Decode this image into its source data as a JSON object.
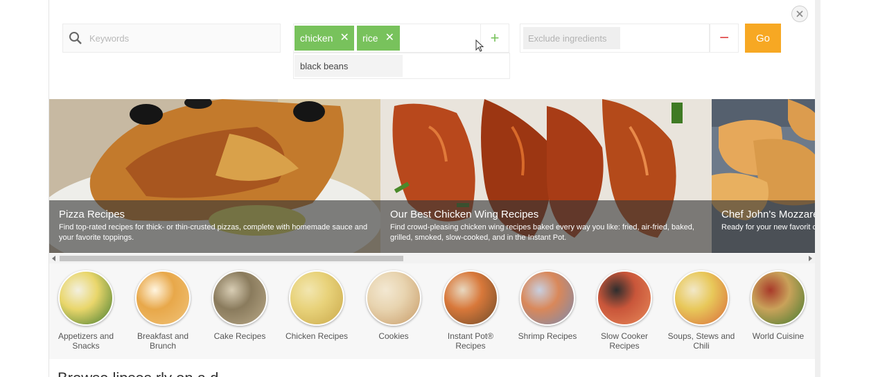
{
  "search": {
    "keyword_placeholder": "Keywords",
    "include_chips": [
      "chicken",
      "rice"
    ],
    "chip_remove_glyph": "✕",
    "suggestion": "black beans",
    "add_glyph": "+",
    "exclude_placeholder": "Exclude ingredients",
    "remove_glyph": "−",
    "go_label": "Go"
  },
  "carousel": [
    {
      "title": "Pizza Recipes",
      "description": "Find top-rated recipes for thick- or thin-crusted pizzas, complete with homemade sauce and your favorite toppings."
    },
    {
      "title": "Our Best Chicken Wing Recipes",
      "description": "Find crowd-pleasing chicken wing recipes baked every way you like: fried, air-fried, baked, grilled, smoked, slow-cooked, and in the Instant Pot."
    },
    {
      "title": "Chef John's Mozzare",
      "description": "Ready for your new favorit crisper, cuter version of m"
    }
  ],
  "categories": [
    {
      "label": "Appetizers and Snacks",
      "colors": [
        "#e9d66b",
        "#3f7a2e",
        "#f3f0e0"
      ]
    },
    {
      "label": "Breakfast and Brunch",
      "colors": [
        "#e8a84a",
        "#f0c37a",
        "#fff5e0"
      ]
    },
    {
      "label": "Cake Recipes",
      "colors": [
        "#8a7b5d",
        "#b9a988",
        "#d8cdb4"
      ]
    },
    {
      "label": "Chicken Recipes",
      "colors": [
        "#e8d27a",
        "#c9a84a",
        "#f2e6b0"
      ]
    },
    {
      "label": "Cookies",
      "colors": [
        "#e8d4b0",
        "#c79a66",
        "#f3e8d2"
      ]
    },
    {
      "label": "Instant Pot® Recipes",
      "colors": [
        "#d8783a",
        "#6b4a2a",
        "#e8d8c0"
      ]
    },
    {
      "label": "Shrimp Recipes",
      "colors": [
        "#d9885a",
        "#7a8ab0",
        "#c8cfe0"
      ]
    },
    {
      "label": "Slow Cooker Recipes",
      "colors": [
        "#c9563a",
        "#e88a5a",
        "#2e2e2e"
      ]
    },
    {
      "label": "Soups, Stews and Chili",
      "colors": [
        "#e8c85a",
        "#d86a3a",
        "#f2e8c8"
      ]
    },
    {
      "label": "World Cuisine",
      "colors": [
        "#c9a25a",
        "#3f7a2e",
        "#a83a2a"
      ]
    }
  ],
  "section_heading": "Browse lipses rly on a d"
}
